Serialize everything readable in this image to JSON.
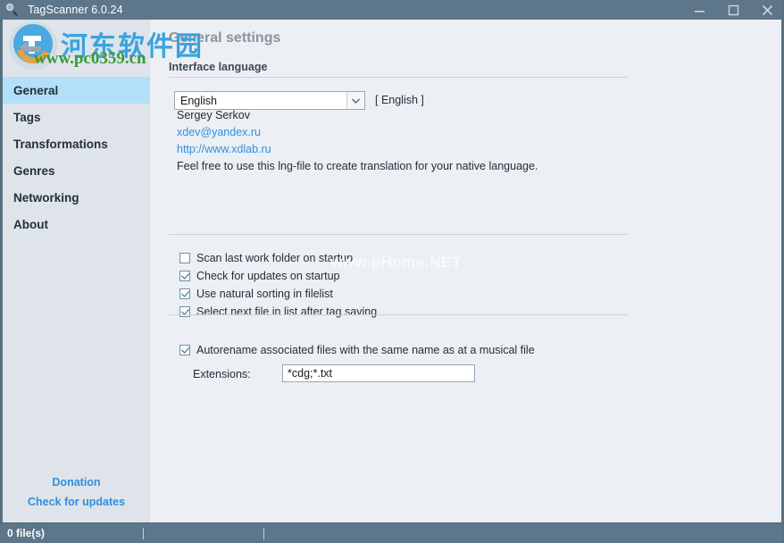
{
  "window": {
    "title": "TagScanner 6.0.24",
    "icon": "magnifier-icon",
    "minimize_label": "Minimize",
    "maximize_label": "Maximize",
    "close_label": "Close",
    "titlebar_color": "#5d7689"
  },
  "sidebar": {
    "items": [
      {
        "label": "General",
        "selected": true
      },
      {
        "label": "Tags",
        "selected": false
      },
      {
        "label": "Transformations",
        "selected": false
      },
      {
        "label": "Genres",
        "selected": false
      },
      {
        "label": "Networking",
        "selected": false
      },
      {
        "label": "About",
        "selected": false
      }
    ],
    "selected_color": "#b3e0f7",
    "bottom_links": [
      {
        "label": "Donation"
      },
      {
        "label": "Check for updates"
      }
    ],
    "link_color": "#2f8fe0"
  },
  "main": {
    "page_title": "General settings",
    "group_label": "Interface language",
    "language_combo": {
      "value": "English",
      "suffix": "[ English ]"
    },
    "translator": {
      "author": "Sergey Serkov",
      "email": "xdev@yandex.ru",
      "website": "http://www.xdlab.ru",
      "note": "Feel free to use this lng-file to create translation for your native language."
    },
    "checkboxes": [
      {
        "label": "Scan last work folder on startup",
        "checked": false
      },
      {
        "label": "Check for updates on startup",
        "checked": true
      },
      {
        "label": "Use natural sorting in filelist",
        "checked": true
      },
      {
        "label": "Select next file in list after tag saving",
        "checked": true
      }
    ],
    "autorename": {
      "label": "Autorename associated files with the same name as at a musical file",
      "checked": true,
      "extensions_label": "Extensions:",
      "extensions_value": "*cdg;*.txt"
    }
  },
  "statusbar": {
    "file_count": "0 file(s)"
  },
  "watermarks": {
    "chinese_text": "河东软件园",
    "url_text": "www.pc0359.cn",
    "faint_text": "www.pHome.NET",
    "chinese_color": "#3aa3e0",
    "url_color": "#3c9a36"
  }
}
